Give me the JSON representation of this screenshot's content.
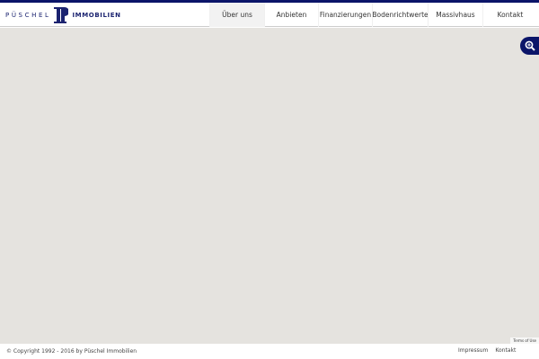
{
  "brand": {
    "word1": "PÜSCHEL",
    "word2": "IMMOBILIEN"
  },
  "nav": [
    {
      "label": "Über uns",
      "active": true
    },
    {
      "label": "Anbieten"
    },
    {
      "label": "Finanzierungen"
    },
    {
      "label": "Bodenrichtwerte"
    },
    {
      "label": "Massivhaus"
    },
    {
      "label": "Kontakt"
    }
  ],
  "map": {
    "terms": "Terms of Use",
    "zoom_icon": "zoom-in-icon"
  },
  "footer": {
    "copyright": "© Copyright 1992 - 2016 by Püschel Immobilien",
    "links": [
      "Impressum",
      "Kontakt"
    ]
  },
  "colors": {
    "brand": "#0b1569",
    "map_bg": "#e5e3df"
  }
}
